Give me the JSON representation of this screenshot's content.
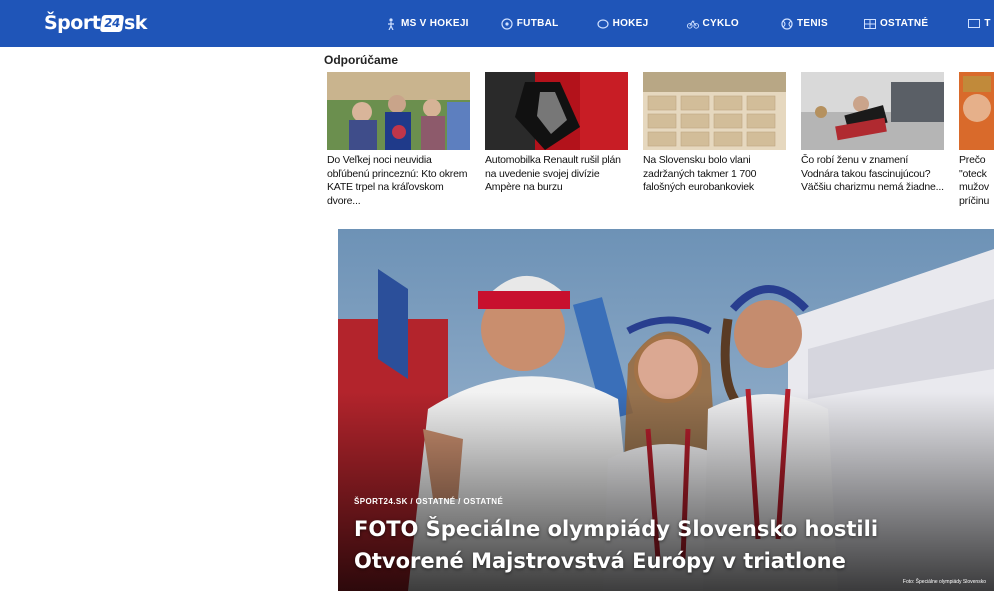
{
  "brand": {
    "logo_prefix": "Šport",
    "logo_box": "24",
    "logo_suffix": "sk"
  },
  "colors": {
    "nav_bg": "#1f55b8",
    "text": "#111111"
  },
  "nav": [
    {
      "label": "MS V HOKEJI",
      "icon": "hockey-player-icon"
    },
    {
      "label": "FUTBAL",
      "icon": "soccer-ball-icon"
    },
    {
      "label": "HOKEJ",
      "icon": "hockey-puck-icon"
    },
    {
      "label": "CYKLO",
      "icon": "bicycle-icon"
    },
    {
      "label": "TENIS",
      "icon": "tennis-ball-icon"
    },
    {
      "label": "OSTATNÉ",
      "icon": "grid-icon"
    },
    {
      "label": "T",
      "icon": "tv-icon"
    }
  ],
  "recommended": {
    "title": "Odporúčame",
    "cards": [
      {
        "text": "Do Veľkej noci neuvidia obľúbenú princeznú: Kto okrem KATE trpel na kráľovskom dvore..."
      },
      {
        "text": "Automobilka Renault rušil plán na uvedenie svojej divízie Ampère na burzu"
      },
      {
        "text": "Na Slovensku bolo vlani zadržaných takmer 1 700 falošných eurobankoviek"
      },
      {
        "text": "Čo robí ženu v znamení Vodnára takou fascinujúcou? Väčšiu charizmu nemá žiadne..."
      },
      {
        "text": "Prečo \"oteck mužov príčinu"
      }
    ]
  },
  "hero": {
    "breadcrumb": "ŠPORT24.SK / OSTATNÉ / OSTATNÉ",
    "title": "FOTO Špeciálne olympiády Slovensko hostili Otvorené Majstrovstvá Európy v triatlone",
    "credit": "Foto: Špeciálne olympiády Slovensko"
  }
}
